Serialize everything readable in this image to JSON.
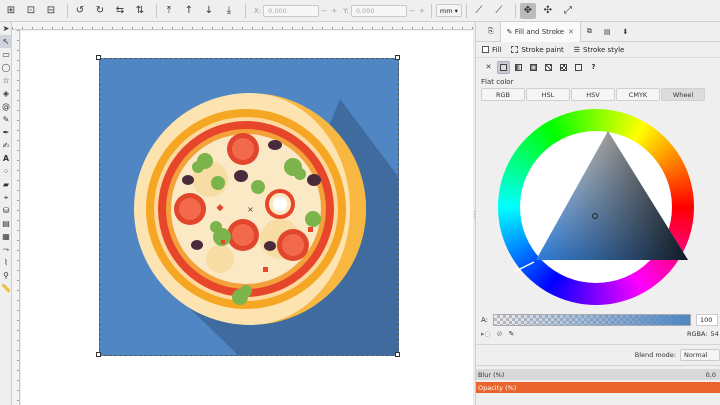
{
  "toolbar": {
    "x_label": "X:",
    "x_value": "0,000",
    "y_label": "Y:",
    "y_value": "0,000",
    "unit": "mm"
  },
  "dock": {
    "tab_fill_stroke": "Fill and Stroke",
    "subtab_fill": "Fill",
    "subtab_stroke_paint": "Stroke paint",
    "subtab_stroke_style": "Stroke style",
    "unknown_paint": "?",
    "flat_color_label": "Flat color",
    "modes": [
      "RGB",
      "HSL",
      "HSV",
      "CMYK",
      "Wheel"
    ],
    "active_mode": "Wheel",
    "alpha_label": "A:",
    "alpha_value": "100",
    "rgba_label": "RGBA:",
    "rgba_value": "54",
    "blend_label": "Blend mode:",
    "blend_value": "Normal",
    "blur_label": "Blur (%)",
    "blur_value": "0,0",
    "opacity_label": "Opacity (%)"
  },
  "colors": {
    "selected_fill": "#4f86c3",
    "accent_opacity": "#e8642c"
  }
}
